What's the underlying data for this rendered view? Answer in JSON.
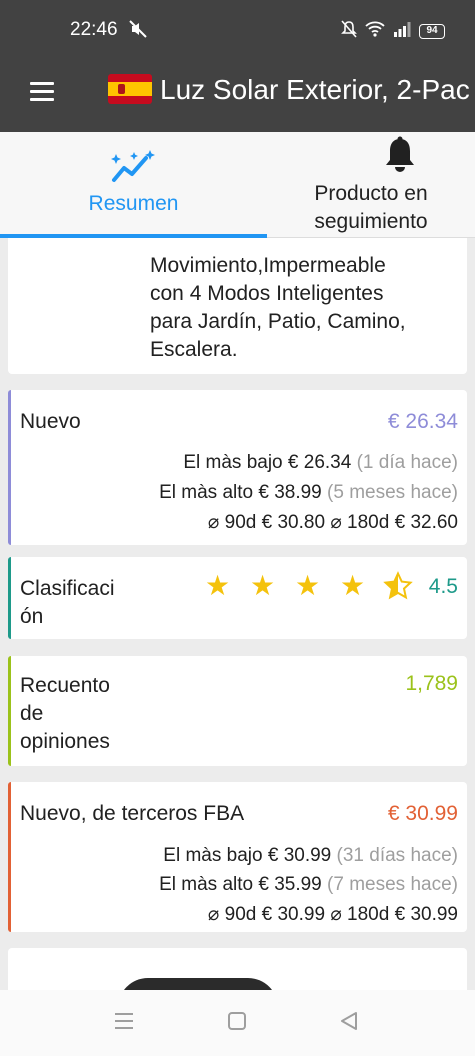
{
  "status_bar": {
    "time": "22:46",
    "battery": "94"
  },
  "app_bar": {
    "title": "Luz Solar Exterior, 2-Pac"
  },
  "tabs": [
    {
      "label": "Resumen",
      "icon": "sparkle-chart-icon",
      "active": true
    },
    {
      "label": "Producto en seguimiento",
      "icon": "bell-icon",
      "active": false
    }
  ],
  "description": {
    "lines": [
      "Movimiento,Impermeable",
      "con 4 Modos Inteligentes",
      "para Jardín, Patio, Camino,",
      "Escalera."
    ]
  },
  "price_new": {
    "label": "Nuevo",
    "value": "€ 26.34",
    "color": "#8e8cd8",
    "lowest_label": "El màs bajo",
    "lowest_value": "€ 26.34",
    "lowest_when": "(1 día hace)",
    "highest_label": "El màs alto",
    "highest_value": "€ 38.99",
    "highest_when": "(5 meses hace)",
    "avg90_label": "⌀ 90d",
    "avg90_value": "€ 30.80",
    "avg180_label": "⌀ 180d",
    "avg180_value": "€ 32.60"
  },
  "rating": {
    "label_line1": "Clasificaci",
    "label_line2": "ón",
    "value": "4.5",
    "stars": 4.5,
    "color": "#1e9a8a"
  },
  "reviews": {
    "label_lines": [
      "Recuento",
      "de",
      "opiniones"
    ],
    "value": "1,789",
    "color": "#9bc21a"
  },
  "price_fba": {
    "label": "Nuevo, de terceros FBA",
    "value": "€ 30.99",
    "color": "#e26135",
    "lowest_label": "El màs bajo",
    "lowest_value": "€ 30.99",
    "lowest_when": "(31 días hace)",
    "highest_label": "El màs alto",
    "highest_value": "€ 35.99",
    "highest_when": "(7 meses hace)",
    "avg90_label": "⌀ 90d",
    "avg90_value": "€ 30.99",
    "avg180_label": "⌀ 180d",
    "avg180_value": "€ 30.99"
  },
  "nav": {
    "recents": "menu-icon",
    "home": "square-icon",
    "back": "triangle-back-icon"
  }
}
